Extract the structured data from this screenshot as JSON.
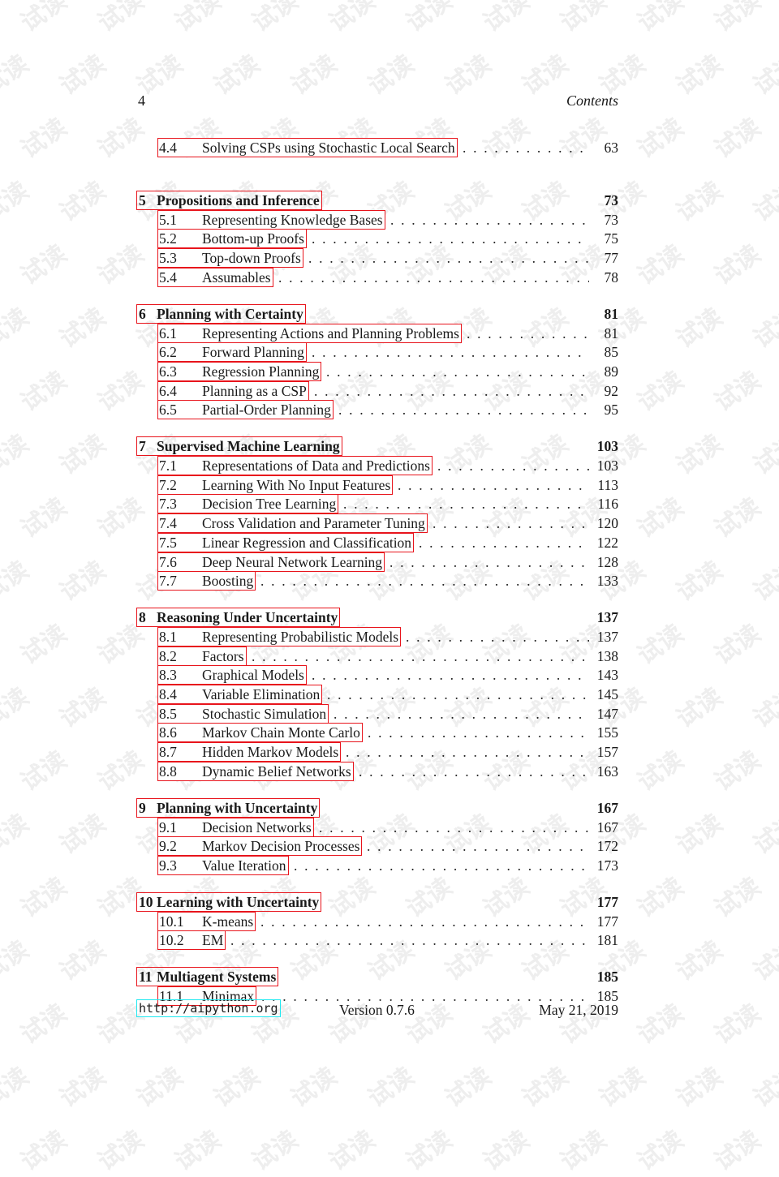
{
  "watermark": {
    "text": "试读",
    "color": "#eeeeee"
  },
  "header": {
    "page_number": "4",
    "running_title": "Contents"
  },
  "toc": [
    {
      "type": "section",
      "num": "4.4",
      "title": "Solving CSPs using Stochastic Local Search",
      "page": "63"
    },
    {
      "type": "chapter",
      "num": "5",
      "title": "Propositions and Inference",
      "page": "73"
    },
    {
      "type": "section",
      "num": "5.1",
      "title": "Representing Knowledge Bases",
      "page": "73"
    },
    {
      "type": "section",
      "num": "5.2",
      "title": "Bottom-up Proofs",
      "page": "75"
    },
    {
      "type": "section",
      "num": "5.3",
      "title": "Top-down Proofs",
      "page": "77"
    },
    {
      "type": "section",
      "num": "5.4",
      "title": "Assumables",
      "page": "78"
    },
    {
      "type": "chapter",
      "num": "6",
      "title": "Planning with Certainty",
      "page": "81"
    },
    {
      "type": "section",
      "num": "6.1",
      "title": "Representing Actions and Planning Problems",
      "page": "81"
    },
    {
      "type": "section",
      "num": "6.2",
      "title": "Forward Planning",
      "page": "85"
    },
    {
      "type": "section",
      "num": "6.3",
      "title": "Regression Planning",
      "page": "89"
    },
    {
      "type": "section",
      "num": "6.4",
      "title": "Planning as a CSP",
      "page": "92"
    },
    {
      "type": "section",
      "num": "6.5",
      "title": "Partial-Order Planning",
      "page": "95"
    },
    {
      "type": "chapter",
      "num": "7",
      "title": "Supervised Machine Learning",
      "page": "103"
    },
    {
      "type": "section",
      "num": "7.1",
      "title": "Representations of Data and Predictions",
      "page": "103"
    },
    {
      "type": "section",
      "num": "7.2",
      "title": "Learning With No Input Features",
      "page": "113"
    },
    {
      "type": "section",
      "num": "7.3",
      "title": "Decision Tree Learning",
      "page": "116"
    },
    {
      "type": "section",
      "num": "7.4",
      "title": "Cross Validation and Parameter Tuning",
      "page": "120"
    },
    {
      "type": "section",
      "num": "7.5",
      "title": "Linear Regression and Classification",
      "page": "122"
    },
    {
      "type": "section",
      "num": "7.6",
      "title": "Deep Neural Network Learning",
      "page": "128"
    },
    {
      "type": "section",
      "num": "7.7",
      "title": "Boosting",
      "page": "133"
    },
    {
      "type": "chapter",
      "num": "8",
      "title": "Reasoning Under Uncertainty",
      "page": "137"
    },
    {
      "type": "section",
      "num": "8.1",
      "title": "Representing Probabilistic Models",
      "page": "137"
    },
    {
      "type": "section",
      "num": "8.2",
      "title": "Factors",
      "page": "138"
    },
    {
      "type": "section",
      "num": "8.3",
      "title": "Graphical Models",
      "page": "143"
    },
    {
      "type": "section",
      "num": "8.4",
      "title": "Variable Elimination",
      "page": "145"
    },
    {
      "type": "section",
      "num": "8.5",
      "title": "Stochastic Simulation",
      "page": "147"
    },
    {
      "type": "section",
      "num": "8.6",
      "title": "Markov Chain Monte Carlo",
      "page": "155"
    },
    {
      "type": "section",
      "num": "8.7",
      "title": "Hidden Markov Models",
      "page": "157"
    },
    {
      "type": "section",
      "num": "8.8",
      "title": "Dynamic Belief Networks",
      "page": "163"
    },
    {
      "type": "chapter",
      "num": "9",
      "title": "Planning with Uncertainty",
      "page": "167"
    },
    {
      "type": "section",
      "num": "9.1",
      "title": "Decision Networks",
      "page": "167"
    },
    {
      "type": "section",
      "num": "9.2",
      "title": "Markov Decision Processes",
      "page": "172"
    },
    {
      "type": "section",
      "num": "9.3",
      "title": "Value Iteration",
      "page": "173"
    },
    {
      "type": "chapter",
      "num": "10",
      "title": "Learning with Uncertainty",
      "page": "177"
    },
    {
      "type": "section",
      "num": "10.1",
      "title": "K-means",
      "page": "177"
    },
    {
      "type": "section",
      "num": "10.2",
      "title": "EM",
      "page": "181"
    },
    {
      "type": "chapter",
      "num": "11",
      "title": "Multiagent Systems",
      "page": "185"
    },
    {
      "type": "section",
      "num": "11.1",
      "title": "Minimax",
      "page": "185"
    }
  ],
  "footer": {
    "url": "http://aipython.org",
    "version": "Version 0.7.6",
    "date": "May 21, 2019"
  },
  "colors": {
    "link_box": "#e8141c",
    "url_box": "#1ee8f0"
  }
}
